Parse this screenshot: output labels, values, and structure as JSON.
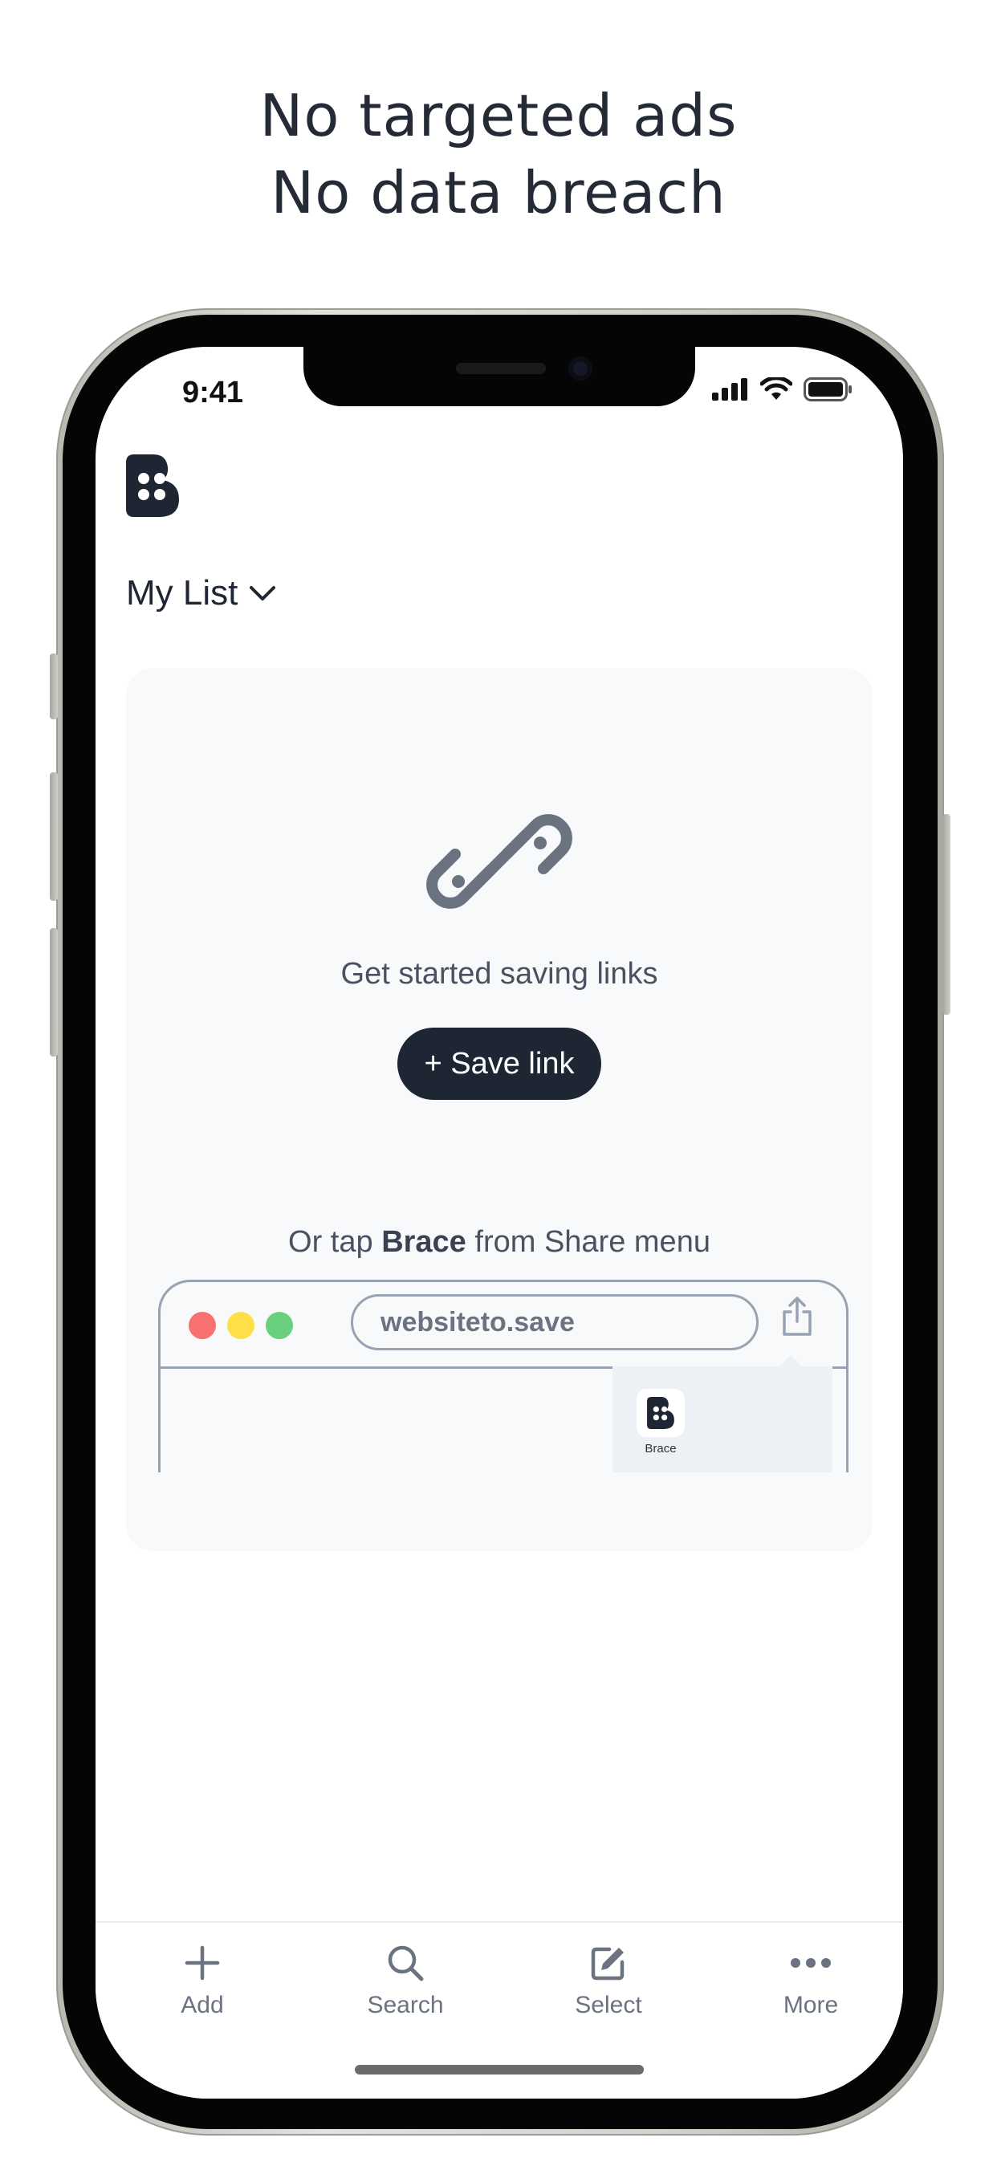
{
  "headline": {
    "line1": "No targeted ads",
    "line2": "No data breach"
  },
  "status_bar": {
    "time": "9:41",
    "icons": [
      "cellular-signal-icon",
      "wifi-icon",
      "battery-icon"
    ]
  },
  "app": {
    "logo_icon": "brace-logo-icon",
    "list_title": "My List",
    "list_dropdown_icon": "chevron-down-icon"
  },
  "empty_state": {
    "icon": "link-icon",
    "message": "Get started saving links",
    "save_button": "+ Save link",
    "share_hint_prefix": "Or tap ",
    "share_hint_app": "Brace",
    "share_hint_suffix": " from Share menu",
    "browser_url": "websiteto.save",
    "share_app_label": "Brace"
  },
  "tabs": [
    {
      "label": "Add",
      "icon": "plus-icon"
    },
    {
      "label": "Search",
      "icon": "search-icon"
    },
    {
      "label": "Select",
      "icon": "edit-icon"
    },
    {
      "label": "More",
      "icon": "more-icon"
    }
  ],
  "colors": {
    "accent": "#1f2633",
    "card_bg": "#f8f9fb",
    "traffic_red": "#f87171",
    "traffic_yellow": "#fde047",
    "traffic_green": "#6ad07d"
  }
}
